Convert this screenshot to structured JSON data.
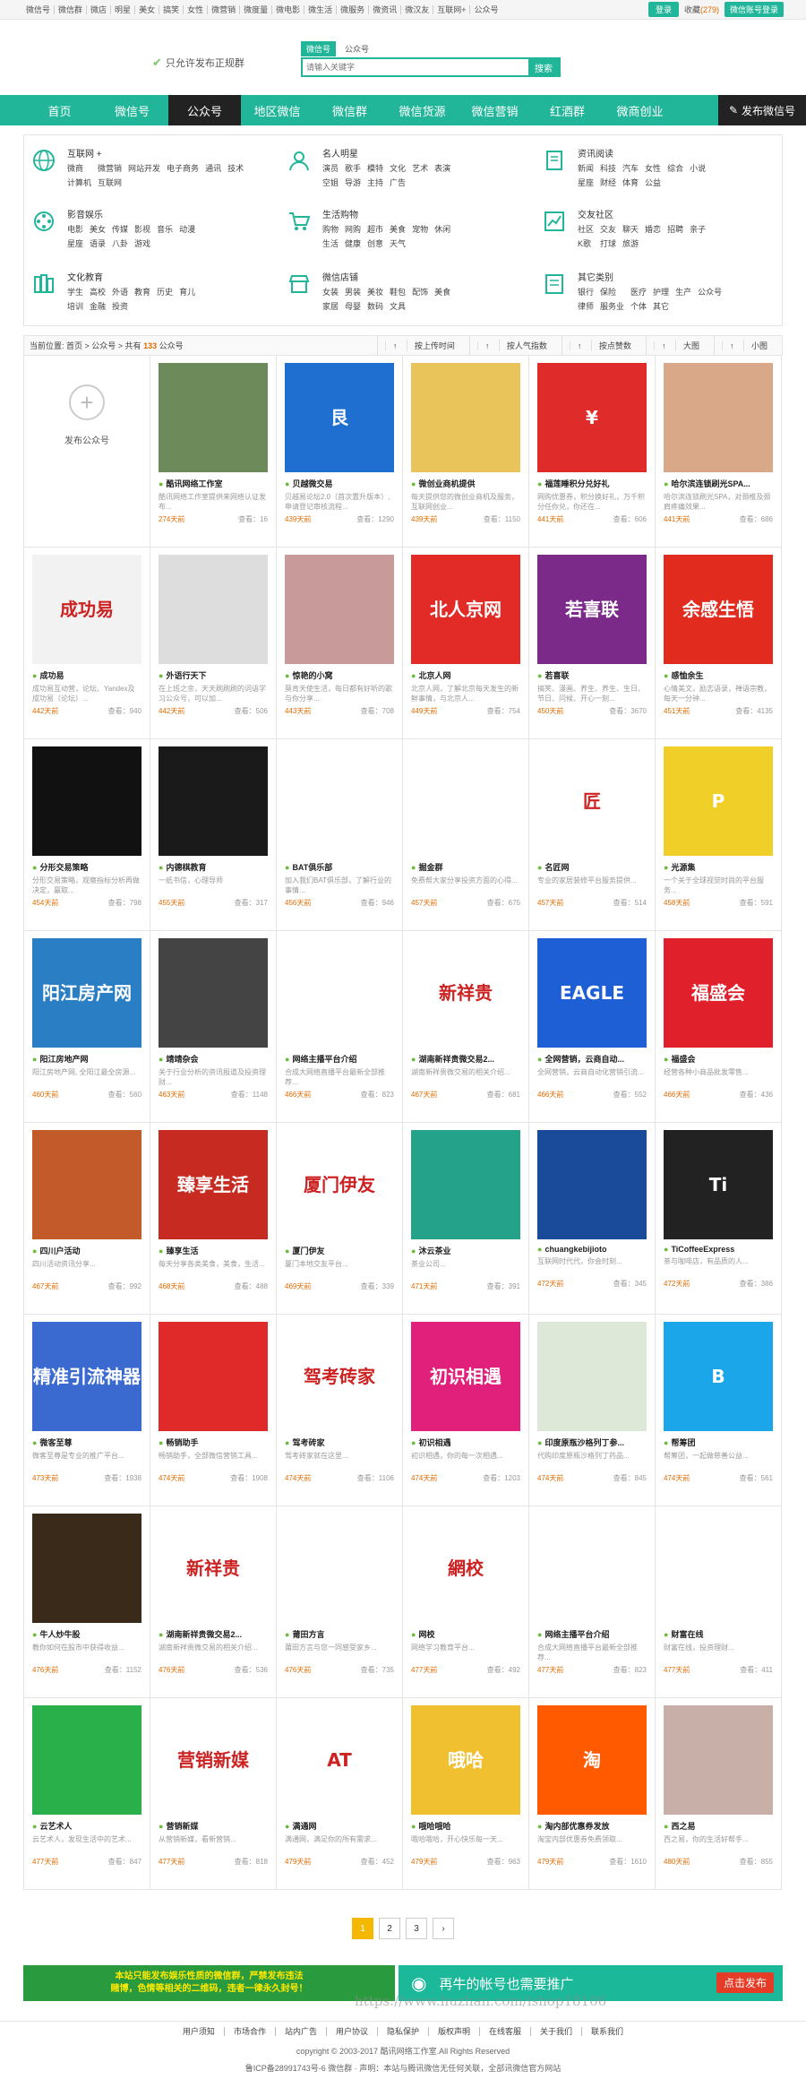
{
  "topbar": {
    "links": [
      "微信号",
      "微信群",
      "微店",
      "明星",
      "美女",
      "搞笑",
      "女性",
      "微营销",
      "微度量",
      "微电影",
      "微生活",
      "微服务",
      "微资讯",
      "微汉友",
      "互联网+",
      "公众号"
    ],
    "login": "登录",
    "fav_label": "收藏",
    "fav_count": "(279)",
    "wx_btn": "微信账号登录"
  },
  "header": {
    "slogan": "只允许发布正规群",
    "search_tabs": [
      "微信号",
      "公众号"
    ],
    "search_placeholder": "请输入关键字",
    "search_btn": "搜索"
  },
  "nav": {
    "items": [
      "首页",
      "微信号",
      "公众号",
      "地区微信",
      "微信群",
      "微信货源",
      "微信营销",
      "红酒群",
      "微商创业"
    ],
    "active": 2,
    "publish": "发布微信号"
  },
  "categories": [
    {
      "title": "互联网 +",
      "icon": "globe-icon",
      "tags": [
        "微商",
        "微营销",
        "网站开发",
        "电子商务",
        "通讯",
        "技术",
        "计算机",
        "互联网"
      ]
    },
    {
      "title": "名人明星",
      "icon": "person-icon",
      "tags": [
        "演员",
        "歌手",
        "模特",
        "文化",
        "艺术",
        "表演",
        "空姐",
        "导游",
        "主持",
        "广告"
      ]
    },
    {
      "title": "资讯阅读",
      "icon": "book-icon",
      "tags": [
        "新闻",
        "科技",
        "汽车",
        "女性",
        "综合",
        "小说",
        "星座",
        "财经",
        "体育",
        "公益"
      ]
    },
    {
      "title": "影音娱乐",
      "icon": "film-icon",
      "tags": [
        "电影",
        "美女",
        "传媒",
        "影视",
        "音乐",
        "动漫",
        "星座",
        "语录",
        "八卦",
        "游戏"
      ]
    },
    {
      "title": "生活购物",
      "icon": "cart-icon",
      "tags": [
        "购物",
        "网购",
        "超市",
        "美食",
        "宠物",
        "休闲",
        "生活",
        "健康",
        "创意",
        "天气"
      ]
    },
    {
      "title": "交友社区",
      "icon": "chart-icon",
      "tags": [
        "社区",
        "交友",
        "聊天",
        "婚恋",
        "招聘",
        "亲子",
        "K歌",
        "打球",
        "旅游"
      ]
    },
    {
      "title": "文化教育",
      "icon": "books-icon",
      "tags": [
        "学生",
        "高校",
        "外语",
        "教育",
        "历史",
        "育儿",
        "培训",
        "金融",
        "投资"
      ]
    },
    {
      "title": "微信店铺",
      "icon": "shop-icon",
      "tags": [
        "女装",
        "男装",
        "美妆",
        "鞋包",
        "配饰",
        "美食",
        "家居",
        "母婴",
        "数码",
        "文具"
      ]
    },
    {
      "title": "其它类别",
      "icon": "note-icon",
      "tags": [
        "银行",
        "保险",
        "医疗",
        "护理",
        "生产",
        "公众号",
        "律师",
        "服务业",
        "个体",
        "其它"
      ]
    }
  ],
  "crumb": {
    "prefix": "当前位置:",
    "path": "首页 > 公众号 > 共有",
    "count": "133",
    "suffix": "公众号",
    "sorts": [
      "按上传时间",
      "按人气指数",
      "按点赞数",
      "大图",
      "小图"
    ]
  },
  "add_card": {
    "label": "发布公众号"
  },
  "cards": [
    {
      "title": "酷讯网络工作室",
      "desc": "酷讯网络工作室提供来网络认证发布...",
      "time": "274天前",
      "views": "查看：16",
      "color": "#6c8a5a",
      "img": ""
    },
    {
      "title": "贝越微交易",
      "desc": "贝越易论坛2.0（首次置升版本）, 申请登记审核流程...",
      "time": "439天前",
      "views": "查看：1290",
      "color": "#1f6fd1",
      "img": "艮"
    },
    {
      "title": "微创业商机提供",
      "desc": "每天提供您的微创业商机及服务，互联网创业...",
      "time": "439天前",
      "views": "查看：1150",
      "color": "#e8c45a",
      "img": ""
    },
    {
      "title": "福莲睡积分兑好礼",
      "desc": "网购优惠券，积分换好礼，万千积分任你兑，你还在...",
      "time": "441天前",
      "views": "查看：606",
      "color": "#e02b2b",
      "img": "¥"
    },
    {
      "title": "哈尔滨连锁刷光SPA...",
      "desc": "哈尔滨连锁刷光SPA，对颈椎及颈肩疼痛效果...",
      "time": "441天前",
      "views": "查看：686",
      "color": "#d8a888",
      "img": ""
    },
    {
      "title": "成功易",
      "desc": "成功易互动营，论坛、Yandex及成功易（论坛）...",
      "time": "442天前",
      "views": "查看：940",
      "color": "#f2f2f2",
      "img": "成功易"
    },
    {
      "title": "外语行天下",
      "desc": "在上班之余，天天刷刷刷的词语学习公众号，可以加...",
      "time": "442天前",
      "views": "查看：506",
      "color": "#dddddd",
      "img": ""
    },
    {
      "title": "惊艳的小窝",
      "desc": "莫肯天使生活，每日都有好听的歌与你分享...",
      "time": "443天前",
      "views": "查看：708",
      "color": "#c89a9a",
      "img": ""
    },
    {
      "title": "北京人网",
      "desc": "北京人网，了解北京每天发生的新鲜事情，与北京人...",
      "time": "449天前",
      "views": "查看：754",
      "color": "#e22a26",
      "img": "北人京网"
    },
    {
      "title": "若喜联",
      "desc": "搞笑、漫画、养生、养生、生日、节日、问候、开心一刻...",
      "time": "450天前",
      "views": "查看：3670",
      "color": "#7c2a8a",
      "img": "若喜联"
    },
    {
      "title": "感恤余生",
      "desc": "心情美文，励志语录，禅语宗教，每天一分钟...",
      "time": "451天前",
      "views": "查看：4135",
      "color": "#e02b1e",
      "img": "余感生悟"
    },
    {
      "title": "分形交易策略",
      "desc": "分形交易策略，观察指标分析再做决定，赢取...",
      "time": "454天前",
      "views": "查看：798",
      "color": "#111111",
      "img": ""
    },
    {
      "title": "内德棋教育",
      "desc": "一纸书信，心理导师",
      "time": "455天前",
      "views": "查看：317",
      "color": "#1a1a1a",
      "img": ""
    },
    {
      "title": "BAT俱乐部",
      "desc": "加入我们BAT俱乐部，了解行业的事情...",
      "time": "456天前",
      "views": "查看：946",
      "color": "#ffffff",
      "img": ""
    },
    {
      "title": "掘金群",
      "desc": "免费帮大家分享投资方面的心得...",
      "time": "457天前",
      "views": "查看：675",
      "color": "#ffffff",
      "img": ""
    },
    {
      "title": "名匠网",
      "desc": "专业的家居装修平台服务提供...",
      "time": "457天前",
      "views": "查看：514",
      "color": "#ffffff",
      "img": "匠"
    },
    {
      "title": "光源集",
      "desc": "一个关于全球视觉时尚的平台服务...",
      "time": "458天前",
      "views": "查看：591",
      "color": "#f0d028",
      "img": "P"
    },
    {
      "title": "阳江房地产网",
      "desc": "阳江房地产网, 全阳江最全房源...",
      "time": "460天前",
      "views": "查看：560",
      "color": "#2a7fc4",
      "img": "阳江房产网"
    },
    {
      "title": "靖靖杂会",
      "desc": "关于行业分析的资讯报道及投资理财...",
      "time": "463天前",
      "views": "查看：1148",
      "color": "#444444",
      "img": ""
    },
    {
      "title": "网络主播平台介绍",
      "desc": "合成大网络直播平台最新全部推荐...",
      "time": "466天前",
      "views": "查看：823",
      "color": "#ffffff",
      "img": ""
    },
    {
      "title": "湖南新祥贵微交易2...",
      "desc": "湖南新祥贵微交易的相关介绍...",
      "time": "467天前",
      "views": "查看：681",
      "color": "#ffffff",
      "img": "新祥贵"
    },
    {
      "title": "全网营销，云商自动...",
      "desc": "全网营销，云商自动化营销引流...",
      "time": "466天前",
      "views": "查看：552",
      "color": "#1e5fd6",
      "img": "EAGLE"
    },
    {
      "title": "福盛会",
      "desc": "经营各种小商品批发零售...",
      "time": "466天前",
      "views": "查看：436",
      "color": "#e0202a",
      "img": "福盛会"
    },
    {
      "title": "四川户活动",
      "desc": "四川活动资讯分享...",
      "time": "467天前",
      "views": "查看：992",
      "color": "#c25a2a",
      "img": ""
    },
    {
      "title": "臻享生活",
      "desc": "每天分享各类美食，美食，生活...",
      "time": "468天前",
      "views": "查看：488",
      "color": "#c62a20",
      "img": "臻享生活"
    },
    {
      "title": "厦门伊友",
      "desc": "厦门本地交友平台...",
      "time": "469天前",
      "views": "查看：339",
      "color": "#ffffff",
      "img": "厦门伊友"
    },
    {
      "title": "沐云茶业",
      "desc": "茶业公司...",
      "time": "471天前",
      "views": "查看：391",
      "color": "#24a38a",
      "img": ""
    },
    {
      "title": "chuangkebijioto",
      "desc": "互联网时代代，你会时刻...",
      "time": "472天前",
      "views": "查看：345",
      "color": "#1a4a9a",
      "img": ""
    },
    {
      "title": "TiCoffeeExpress",
      "desc": "茶与咖啡店，有品质的人...",
      "time": "472天前",
      "views": "查看：386",
      "color": "#222222",
      "img": "Ti"
    },
    {
      "title": "微客至尊",
      "desc": "微客至尊是专业的推广平台...",
      "time": "473天前",
      "views": "查看：1938",
      "color": "#3a6ad0",
      "img": "精准引流神器"
    },
    {
      "title": "畅销助手",
      "desc": "畅销助手，全部微信营销工具...",
      "time": "474天前",
      "views": "查看：1908",
      "color": "#e02a2a",
      "img": ""
    },
    {
      "title": "驾考砖家",
      "desc": "驾考砖家就在这里...",
      "time": "474天前",
      "views": "查看：1106",
      "color": "#ffffff",
      "img": "驾考砖家"
    },
    {
      "title": "初识相遇",
      "desc": "初识相遇，你的每一次相遇...",
      "time": "474天前",
      "views": "查看：1203",
      "color": "#e0207a",
      "img": "初识相遇"
    },
    {
      "title": "印度原瓶沙格列丁参...",
      "desc": "代购印度原瓶沙格列丁药品...",
      "time": "474天前",
      "views": "查看：845",
      "color": "#dde8d8",
      "img": ""
    },
    {
      "title": "帮筹团",
      "desc": "帮筹团，一起做慈善公益...",
      "time": "474天前",
      "views": "查看：561",
      "color": "#1aa6e8",
      "img": "B"
    },
    {
      "title": "牛人炒牛股",
      "desc": "教你如何在股市中获得收益...",
      "time": "476天前",
      "views": "查看：1152",
      "color": "#3a2a1a",
      "img": ""
    },
    {
      "title": "湖南新祥贵微交易2...",
      "desc": "湖南新祥贵微交易的相关介绍...",
      "time": "476天前",
      "views": "查看：536",
      "color": "#ffffff",
      "img": "新祥贵"
    },
    {
      "title": "莆田方言",
      "desc": "莆田方言与您一同感受家乡...",
      "time": "476天前",
      "views": "查看：735",
      "color": "#ffffff",
      "img": ""
    },
    {
      "title": "网校",
      "desc": "网络学习教育平台...",
      "time": "477天前",
      "views": "查看：492",
      "color": "#ffffff",
      "img": "網校"
    },
    {
      "title": "网络主播平台介绍",
      "desc": "合成大网络直播平台最新全部推荐...",
      "time": "477天前",
      "views": "查看：823",
      "color": "#ffffff",
      "img": ""
    },
    {
      "title": "财富在线",
      "desc": "财富在线，投资理财...",
      "time": "477天前",
      "views": "查看：411",
      "color": "#ffffff",
      "img": ""
    },
    {
      "title": "云艺术人",
      "desc": "云艺术人，发现生活中的艺术...",
      "time": "477天前",
      "views": "查看：847",
      "color": "#2ab04a",
      "img": ""
    },
    {
      "title": "营销新媒",
      "desc": "从营销新媒，看新营销...",
      "time": "477天前",
      "views": "查看：818",
      "color": "#ffffff",
      "img": "营销新媒"
    },
    {
      "title": "满通网",
      "desc": "满通网，满足你的所有需求...",
      "time": "479天前",
      "views": "查看：452",
      "color": "#ffffff",
      "img": "AT"
    },
    {
      "title": "哦哈哦哈",
      "desc": "哦哈哦哈，开心快乐每一天...",
      "time": "479天前",
      "views": "查看：963",
      "color": "#f0c030",
      "img": "哦哈"
    },
    {
      "title": "淘内部优惠券发放",
      "desc": "淘宝内部优惠券免费领取...",
      "time": "479天前",
      "views": "查看：1610",
      "color": "#ff5a00",
      "img": "淘"
    },
    {
      "title": "西之易",
      "desc": "西之易，你的生活好帮手...",
      "time": "480天前",
      "views": "查看：855",
      "color": "#c8b0a8",
      "img": ""
    }
  ],
  "pager": [
    "1",
    "2",
    "3",
    "›"
  ],
  "banner1": {
    "line1": "本站只能发布娱乐性质的微信群，严禁发布违法",
    "line2": "赌博，色情等相关的二维码，违者一律永久封号！"
  },
  "banner2": {
    "text": "再牛的帐号也需要推广",
    "btn": "点击发布"
  },
  "footer": {
    "links": [
      "用户须知",
      "市场合作",
      "站内广告",
      "用户协议",
      "隐私保护",
      "版权声明",
      "在线客服",
      "关于我们",
      "联系我们"
    ],
    "copy": "copyright © 2003-2017 酷讯网络工作室.All Rights Reserved",
    "icp": "鲁ICP备28991743号-6 微信群 · 声明：本站与腾讯微信无任何关联，全部讯微信官方网站"
  },
  "watermark": "https://www.huzhan.com/ishop18106"
}
